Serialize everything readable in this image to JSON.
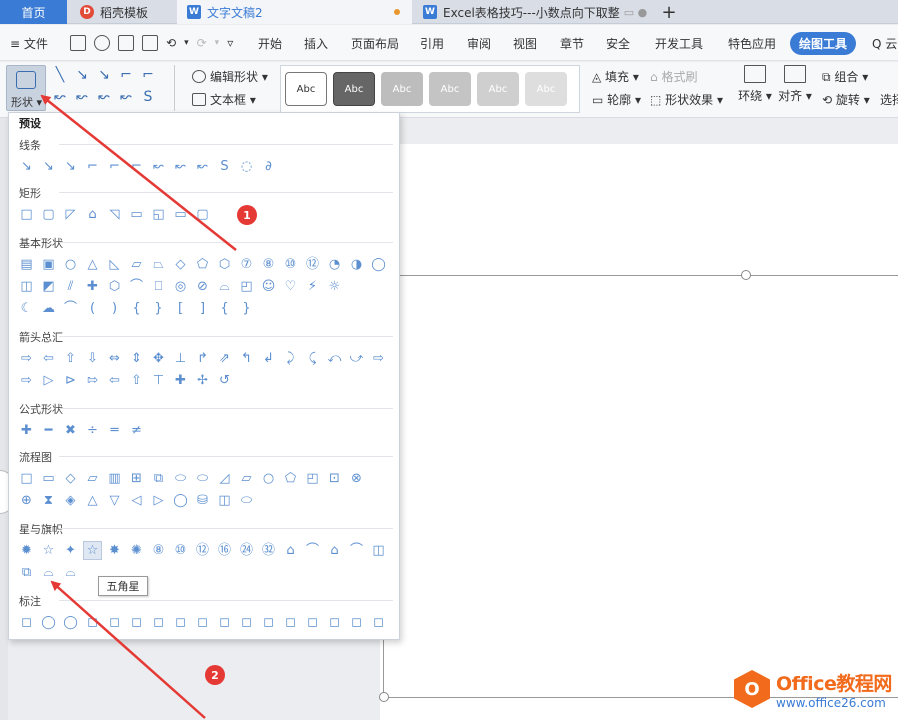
{
  "tabs": [
    {
      "label": "首页",
      "active": false
    },
    {
      "label": "稻壳模板",
      "icon": "daoke-icon"
    },
    {
      "label": "文字文稿2",
      "icon": "writer-icon",
      "modified": true,
      "active": true
    },
    {
      "label": "Excel表格技巧---小数点向下取整",
      "icon": "writer-icon"
    }
  ],
  "tab_add": "+",
  "menu": {
    "file": "≡ 文件",
    "quick_glyphs": [
      "⟲",
      "▾",
      "⟳",
      "▾",
      "▿"
    ],
    "items": [
      "开始",
      "插入",
      "页面布局",
      "引用",
      "审阅",
      "视图",
      "章节",
      "安全",
      "开发工具",
      "特色应用"
    ],
    "active": "绘图工具",
    "cloud": "Q 云"
  },
  "toolbar": {
    "shape_label": "形状 ▾",
    "edit_shape": "编辑形状 ▾",
    "textbox": "文本框 ▾",
    "style_boxes": [
      "Abc",
      "Abc",
      "Abc",
      "Abc",
      "Abc",
      "Abc"
    ],
    "fill": "填充 ▾",
    "format_brush": "格式刷",
    "outline": "轮廓 ▾",
    "shape_effect": "形状效果 ▾",
    "wrap": "环绕 ▾",
    "align": "对齐 ▾",
    "group": "组合 ▾",
    "rotate": "旋转 ▾",
    "select": "选择"
  },
  "popup": {
    "title": "预设",
    "sections": [
      {
        "name": "线条",
        "rows": [
          [
            "↘",
            "↘",
            "↘",
            "⌐",
            "⌐",
            "⌐",
            "↜",
            "↜",
            "↜",
            "S",
            "◌",
            "∂"
          ]
        ]
      },
      {
        "name": "矩形",
        "rows": [
          [
            "□",
            "▢",
            "◸",
            "⌂",
            "◹",
            "▭",
            "◱",
            "▭",
            "▢"
          ]
        ]
      },
      {
        "name": "基本形状",
        "rows": [
          [
            "▤",
            "▣",
            "○",
            "△",
            "◺",
            "▱",
            "⏢",
            "◇",
            "⬠",
            "⬡",
            "⑦",
            "⑧",
            "⑩",
            "⑫",
            "◔",
            "◑",
            "◯"
          ],
          [
            "◫",
            "◩",
            "⫽",
            "✚",
            "⬡",
            "⌒",
            "⎕",
            "◎",
            "⊘",
            "⌓",
            "◰",
            "☺",
            "♡",
            "⚡",
            "☼"
          ],
          [
            "☾",
            "☁",
            "⌒",
            "(",
            ")",
            "{",
            "}",
            "[",
            "]",
            "{",
            "}"
          ]
        ]
      },
      {
        "name": "箭头总汇",
        "rows": [
          [
            "⇨",
            "⇦",
            "⇧",
            "⇩",
            "⇔",
            "⇕",
            "✥",
            "⊥",
            "↱",
            "⇗",
            "↰",
            "↲",
            "⤸",
            "⤹",
            "⤺",
            "⤻",
            "⇨"
          ],
          [
            "⇨",
            "▷",
            "⊳",
            "⇰",
            "⇦",
            "⇧",
            "⊤",
            "✚",
            "✢",
            "↺"
          ]
        ]
      },
      {
        "name": "公式形状",
        "rows": [
          [
            "✚",
            "━",
            "✖",
            "÷",
            "═",
            "≠"
          ]
        ]
      },
      {
        "name": "流程图",
        "rows": [
          [
            "□",
            "▭",
            "◇",
            "▱",
            "▥",
            "⊞",
            "⧉",
            "⬭",
            "⬭",
            "◿",
            "▱",
            "○",
            "⬠",
            "◰",
            "⊡",
            "⊗"
          ],
          [
            "⊕",
            "⧗",
            "◈",
            "△",
            "▽",
            "◁",
            "▷",
            "◯",
            "⛁",
            "◫",
            "⬭"
          ]
        ]
      },
      {
        "name": "星与旗帜",
        "rows": [
          [
            "✹",
            "☆",
            "✦",
            "☆",
            "✸",
            "✺",
            "⑧",
            "⑩",
            "⑫",
            "⑯",
            "㉔",
            "㉜",
            "⌂",
            "⌒",
            "⌂",
            "⌒",
            "◫"
          ],
          [
            "⧉",
            "⌓",
            "⌓"
          ]
        ]
      },
      {
        "name": "标注",
        "rows": [
          [
            "◻",
            "◯",
            "◯",
            "◻",
            "◻",
            "◻",
            "◻",
            "◻",
            "◻",
            "◻",
            "◻",
            "◻",
            "◻",
            "◻",
            "◻",
            "◻",
            "◻"
          ]
        ]
      }
    ],
    "tooltip": "五角星"
  },
  "badges": [
    "1",
    "2"
  ],
  "watermark": {
    "line1": "Office教程网",
    "line2": "www.office26.com"
  },
  "colors": {
    "accent": "#3a7bd5",
    "arrow": "#e53935",
    "brand": "#f26a1b"
  }
}
